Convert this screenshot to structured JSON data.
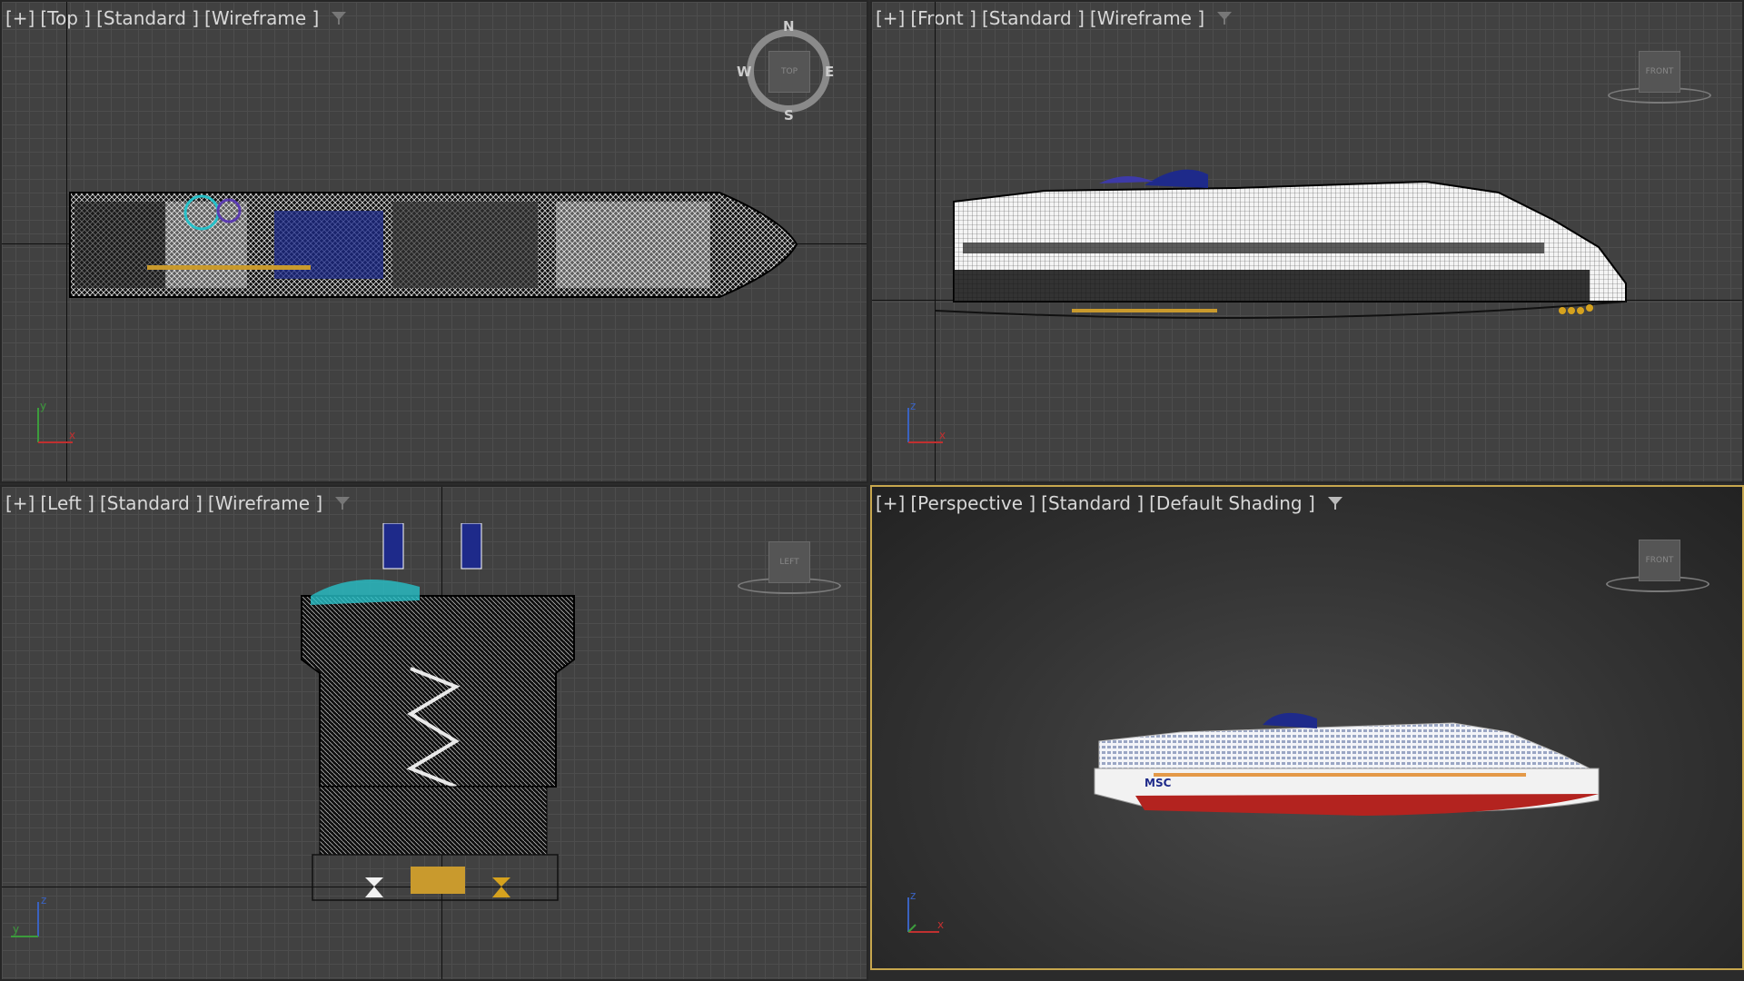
{
  "viewports": {
    "top": {
      "plus": "[+]",
      "view": "[Top ]",
      "preset": "[Standard ]",
      "mode": "[Wireframe ]",
      "cube_label": "TOP",
      "compass": {
        "n": "N",
        "s": "S",
        "e": "E",
        "w": "W"
      },
      "axis": {
        "a": "y",
        "b": "x"
      }
    },
    "front": {
      "plus": "[+]",
      "view": "[Front ]",
      "preset": "[Standard ]",
      "mode": "[Wireframe ]",
      "cube_label": "FRONT",
      "axis": {
        "a": "z",
        "b": "x"
      }
    },
    "left": {
      "plus": "[+]",
      "view": "[Left ]",
      "preset": "[Standard ]",
      "mode": "[Wireframe ]",
      "cube_label": "LEFT",
      "axis": {
        "a": "z",
        "b": "y"
      }
    },
    "perspective": {
      "plus": "[+]",
      "view": "[Perspective ]",
      "preset": "[Standard ]",
      "mode": "[Default Shading ]",
      "cube_label": "FRONT",
      "axis": {
        "a": "z",
        "b": "x"
      },
      "hull_text": "MSC"
    }
  },
  "colors": {
    "grid_bg": "#414141",
    "active_border": "#c7a74e",
    "hull_red": "#b3231f",
    "funnel_blue": "#1e2a8a"
  },
  "icons": [
    "filter-icon",
    "viewcube",
    "compass-ring",
    "axis-tripod"
  ]
}
